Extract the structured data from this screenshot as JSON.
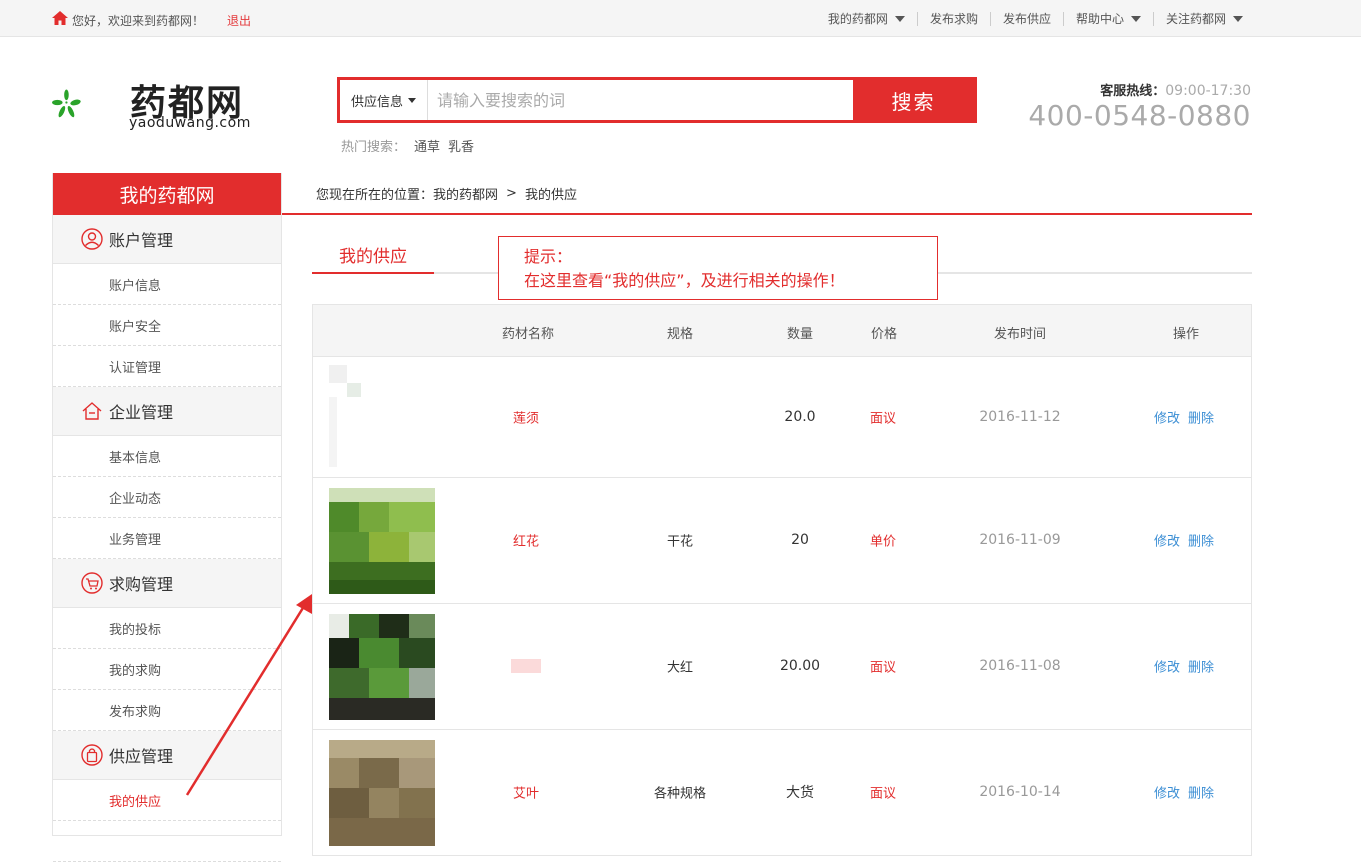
{
  "topbar": {
    "welcome": "您好，欢迎来到药都网！",
    "logout": "退出",
    "nav": [
      {
        "label": "我的药都网",
        "dropdown": true
      },
      {
        "label": "发布求购",
        "dropdown": false
      },
      {
        "label": "发布供应",
        "dropdown": false
      },
      {
        "label": "帮助中心",
        "dropdown": true
      },
      {
        "label": "关注药都网",
        "dropdown": true
      }
    ]
  },
  "header": {
    "logo_name": "药都网",
    "logo_domain": "yaoduwang.com",
    "search": {
      "category": "供应信息",
      "placeholder": "请输入要搜索的词",
      "button": "搜索"
    },
    "hot": {
      "label": "热门搜索：",
      "keywords": [
        "通草",
        "乳香"
      ]
    },
    "service": {
      "label": "客服热线：",
      "hours": "09:00-17:30",
      "phone": "400-0548-0880"
    }
  },
  "sidebar": {
    "title": "我的药都网",
    "groups": [
      {
        "label": "账户管理",
        "icon": "user-icon",
        "links": [
          "账户信息",
          "账户安全",
          "认证管理"
        ]
      },
      {
        "label": "企业管理",
        "icon": "home-icon",
        "links": [
          "基本信息",
          "企业动态",
          "业务管理"
        ]
      },
      {
        "label": "求购管理",
        "icon": "cart-icon",
        "links": [
          "我的投标",
          "我的求购",
          "发布求购"
        ]
      },
      {
        "label": "供应管理",
        "icon": "bag-icon",
        "links": [
          "我的供应"
        ]
      }
    ],
    "active_link": "我的供应"
  },
  "breadcrumb": {
    "prefix": "您现在所在的位置：",
    "items": [
      "我的药都网",
      "我的供应"
    ],
    "separator": ">"
  },
  "tab": "我的供应",
  "tip": {
    "title": "提示：",
    "text": "在这里查看“我的供应”，及进行相关的操作！"
  },
  "table": {
    "headers": [
      "药材名称",
      "规格",
      "数量",
      "价格",
      "发布时间",
      "操作"
    ],
    "edit_label": "修改",
    "delete_label": "删除",
    "rows": [
      {
        "name": "莲须",
        "spec": "",
        "qty": "20.0",
        "price": "面议",
        "date": "2016-11-12"
      },
      {
        "name": "红花",
        "spec": "干花",
        "qty": "20",
        "price": "单价",
        "date": "2016-11-09"
      },
      {
        "name": "",
        "spec": "大红",
        "qty": "20.00",
        "price": "面议",
        "date": "2016-11-08"
      },
      {
        "name": "艾叶",
        "spec": "各种规格",
        "qty": "大货",
        "price": "面议",
        "date": "2016-10-14"
      }
    ]
  },
  "colors": {
    "brand_red": "#e22d2d",
    "link_blue": "#3b8ed4",
    "logo_green": "#2aa32a"
  }
}
